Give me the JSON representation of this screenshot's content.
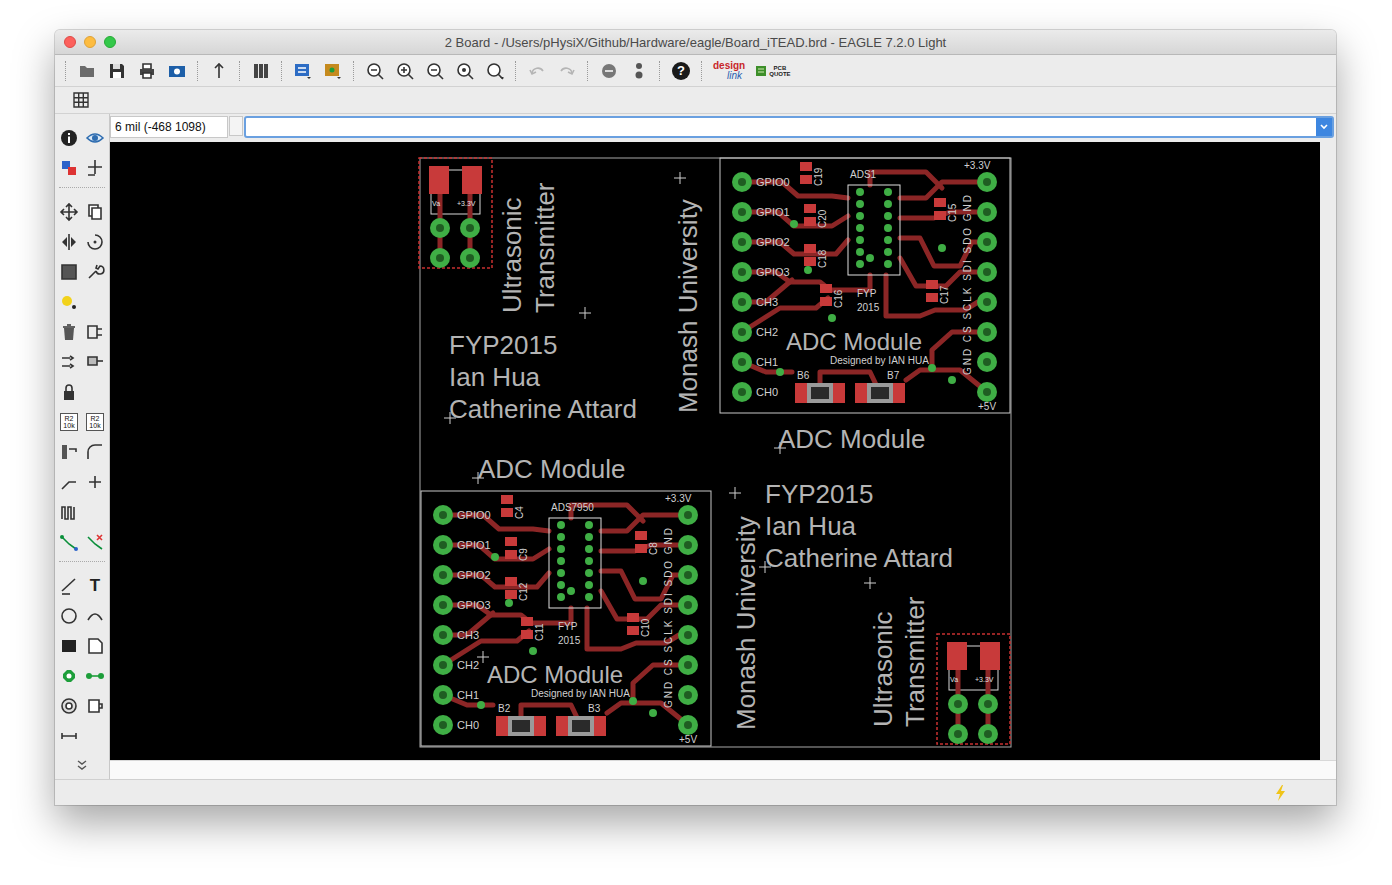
{
  "window": {
    "title": "2 Board - /Users/pHysiX/Github/Hardware/eagle/Board_iTEAD.brd - EAGLE 7.2.0 Light"
  },
  "toolbar": {
    "help": "?",
    "design_link": [
      "design",
      "link"
    ],
    "pcb_quote": [
      "PCB",
      "QUOTE"
    ]
  },
  "command": {
    "coordinates": "6 mil (-468 1098)"
  },
  "palette": {
    "value_tool": [
      "R2",
      "10k"
    ],
    "value_tool_alt": [
      "R2",
      "10k"
    ],
    "text_tool": "T"
  },
  "board": {
    "adc_modules": [
      {
        "chip": "ADS1",
        "title": "ADC Module",
        "credit": "Designed by IAN HUA",
        "project": [
          "FYP",
          "2015"
        ],
        "left_pins": [
          "GPIO0",
          "GPIO1",
          "GPIO2",
          "GPIO3",
          "CH3",
          "CH2",
          "CH1",
          "CH0"
        ],
        "power_top": "+3.3V",
        "power_bottom": "+5V",
        "bus": "GND  CS  SCLK  SDI  SDO  GND",
        "caps": [
          "C19",
          "C20",
          "C18",
          "C16",
          "C17",
          "C15"
        ],
        "buttons": [
          "B6",
          "B7"
        ]
      },
      {
        "chip": "ADS7950",
        "title": "ADC Module",
        "credit": "Designed by IAN HUA",
        "project": [
          "FYP",
          "2015"
        ],
        "left_pins": [
          "GPIO0",
          "GPIO1",
          "GPIO2",
          "GPIO3",
          "CH3",
          "CH2",
          "CH1",
          "CH0"
        ],
        "power_top": "+3.3V",
        "power_bottom": "+5V",
        "bus": "GND  CS  SCLK  SDI  SDO  GND",
        "caps": [
          "C4",
          "C9",
          "C12",
          "C11",
          "C10",
          "C8"
        ],
        "buttons": [
          "B2",
          "B3"
        ]
      }
    ],
    "transmitters": [
      {
        "labels": [
          "Va",
          "+3.3V"
        ]
      },
      {
        "labels": [
          "Va",
          "+3.3V"
        ]
      }
    ],
    "credits": [
      {
        "project": "FYP2015",
        "authors": [
          "Ian Hua",
          "Catherine Attard"
        ],
        "university": "Monash University",
        "product": [
          "Ultrasonic",
          "Transmitter"
        ],
        "module_label": "ADC Module"
      },
      {
        "project": "FYP2015",
        "authors": [
          "Ian Hua",
          "Catherine Attard"
        ],
        "university": "Monash University",
        "product": [
          "Ultrasonic",
          "Transmitter"
        ],
        "module_label": "ADC Module"
      }
    ]
  }
}
